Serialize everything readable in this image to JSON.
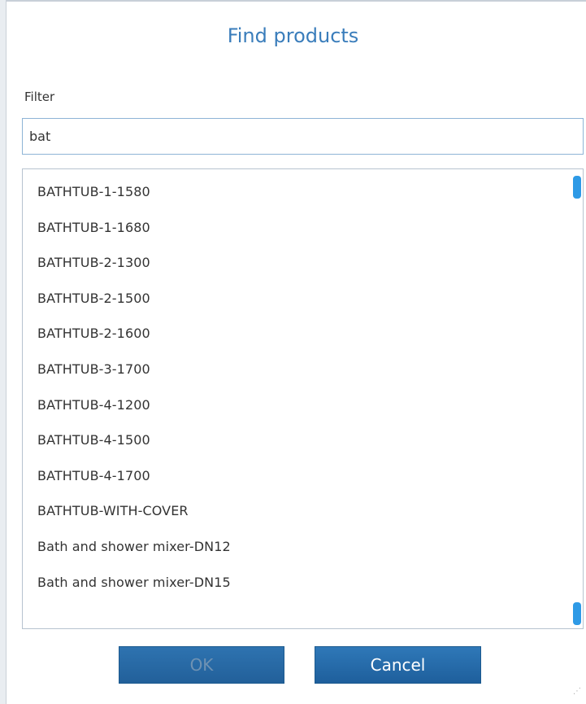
{
  "dialog": {
    "title": "Find products"
  },
  "filter": {
    "label": "Filter",
    "value": "bat"
  },
  "products": [
    "BATHTUB-1-1580",
    "BATHTUB-1-1680",
    "BATHTUB-2-1300",
    "BATHTUB-2-1500",
    "BATHTUB-2-1600",
    "BATHTUB-3-1700",
    "BATHTUB-4-1200",
    "BATHTUB-4-1500",
    "BATHTUB-4-1700",
    "BATHTUB-WITH-COVER",
    "Bath and shower mixer-DN12",
    "Bath and shower mixer-DN15"
  ],
  "buttons": {
    "ok_label": "OK",
    "cancel_label": "Cancel"
  },
  "colors": {
    "title": "#3a7dbb",
    "button": "#2f78b8",
    "scroll_thumb": "#2e9ae6"
  }
}
